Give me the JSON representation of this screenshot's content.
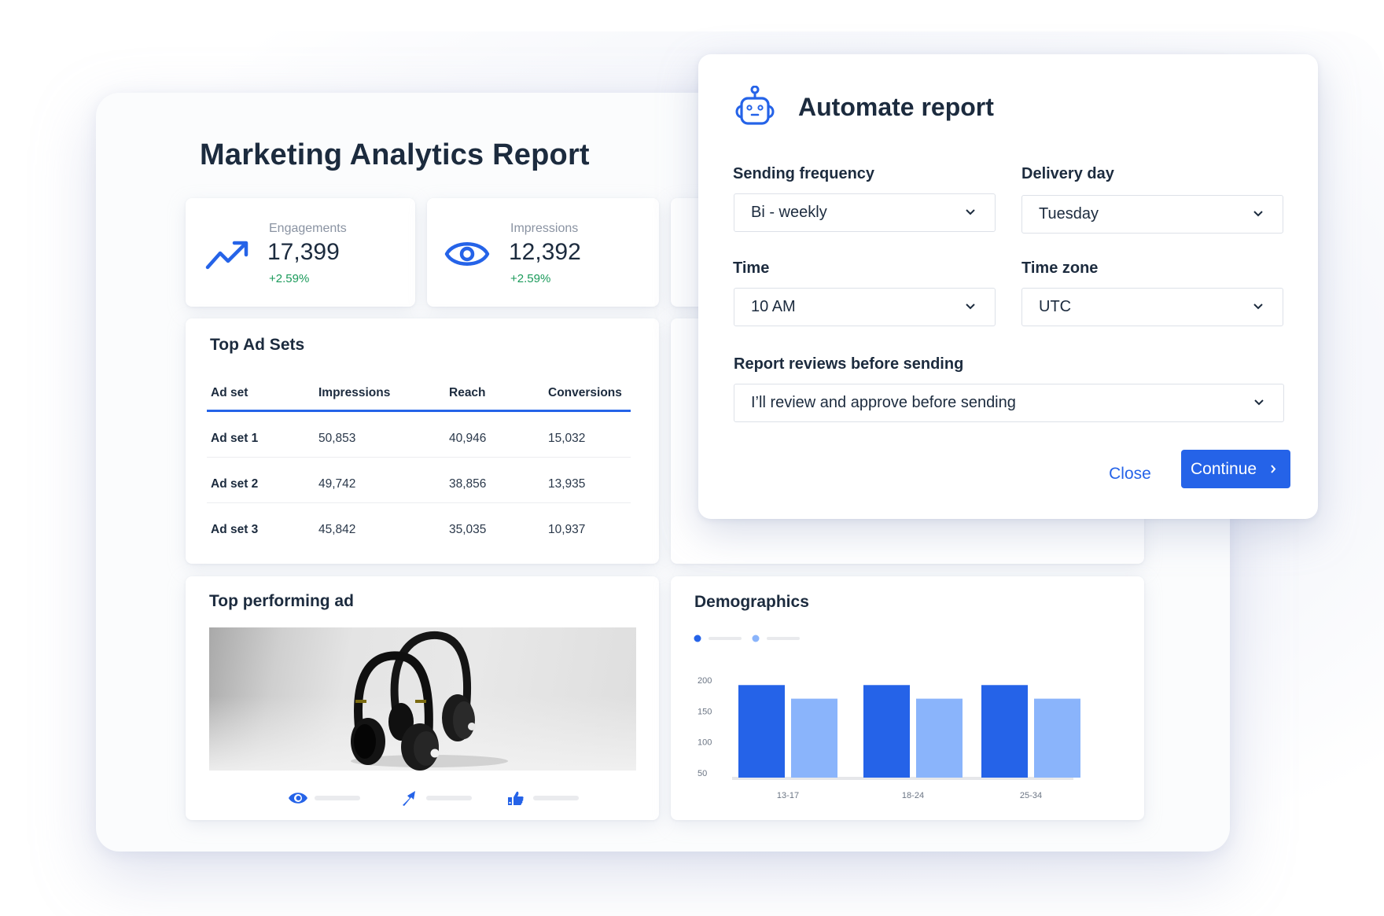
{
  "page": {
    "title": "Marketing Analytics Report"
  },
  "kpis": [
    {
      "label": "Engagements",
      "value": "17,399",
      "change": "+2.59%",
      "icon": "trending-up-icon"
    },
    {
      "label": "Impressions",
      "value": "12,392",
      "change": "+2.59%",
      "icon": "eye-icon"
    }
  ],
  "top_ad_sets": {
    "title": "Top Ad Sets",
    "columns": [
      "Ad set",
      "Impressions",
      "Reach",
      "Conversions"
    ],
    "rows": [
      [
        "Ad set 1",
        "50,853",
        "40,946",
        "15,032"
      ],
      [
        "Ad set 2",
        "49,742",
        "38,856",
        "13,935"
      ],
      [
        "Ad set 3",
        "45,842",
        "35,035",
        "10,937"
      ]
    ]
  },
  "top_ad": {
    "title": "Top performing ad",
    "image": "headphones-product-photo",
    "metric_icons": [
      "eye-icon",
      "send-arrow-icon",
      "thumbs-up-icon"
    ]
  },
  "demographics": {
    "title": "Demographics"
  },
  "chart_data": {
    "type": "bar",
    "title": "Demographics",
    "categories": [
      "13-17",
      "18-24",
      "25-34"
    ],
    "series": [
      {
        "name": "",
        "color": "#2563e8",
        "values": [
          192,
          192,
          192
        ]
      },
      {
        "name": "",
        "color": "#8ab4fb",
        "values": [
          170,
          170,
          170
        ]
      }
    ],
    "yticks": [
      50,
      100,
      150,
      200
    ],
    "ylim": [
      42,
      205
    ],
    "xlabel": "",
    "ylabel": "",
    "grid": false,
    "legend": "top-left"
  },
  "modal": {
    "title": "Automate report",
    "icon": "robot-icon",
    "fields": {
      "frequency": {
        "label": "Sending frequency",
        "value": "Bi - weekly"
      },
      "delivery_day": {
        "label": "Delivery day",
        "value": "Tuesday"
      },
      "time": {
        "label": "Time",
        "value": "10 AM"
      },
      "time_zone": {
        "label": "Time zone",
        "value": "UTC"
      },
      "review": {
        "label": "Report reviews before sending",
        "value": "I’ll review and approve before sending"
      }
    },
    "close_label": "Close",
    "continue_label": "Continue"
  },
  "colors": {
    "accent": "#2563e8",
    "accent_light": "#8ab4fb",
    "positive": "#1a9a5a",
    "text": "#1c2b3e"
  }
}
